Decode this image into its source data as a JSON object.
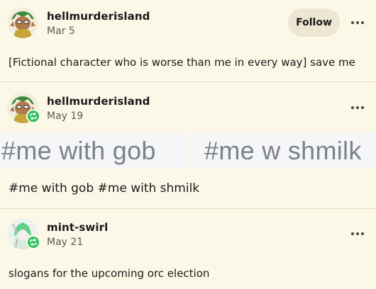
{
  "posts": [
    {
      "username": "hellmurderisland",
      "date": "Mar 5",
      "follow_label": "Follow",
      "body": "[Fictional character who is worse than me in every way] save me"
    },
    {
      "username": "hellmurderisland",
      "date": "May 19",
      "image_texts": [
        "#me with gob",
        "#me w shmilk"
      ],
      "body": "#me with gob #me with shmilk"
    },
    {
      "username": "mint-swirl",
      "date": "May 21",
      "body": "slogans for the upcoming orc election"
    }
  ],
  "icons": {
    "more": "more-dots-icon",
    "reblog": "reblog-icon"
  },
  "colors": {
    "background": "#fcf8e8",
    "reblog_green": "#29c25b",
    "follow_button_bg": "#ece6d2",
    "divider": "#e5dfc9"
  }
}
